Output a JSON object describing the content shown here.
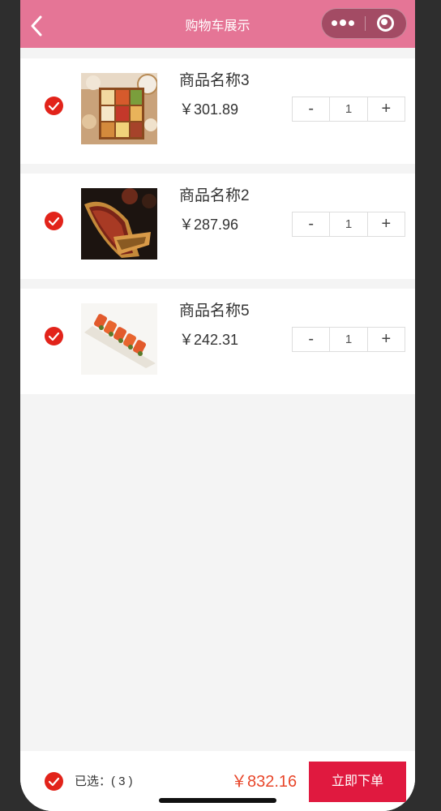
{
  "navbar": {
    "title": "购物车展示",
    "color": "#e57596"
  },
  "cart": {
    "currency": "￥",
    "items": [
      {
        "name": "商品名称3",
        "price": "￥301.89",
        "qty": "1",
        "image": "bento-box-image",
        "checked": true
      },
      {
        "name": "商品名称2",
        "price": "￥287.96",
        "qty": "1",
        "image": "grilled-sandwich-image",
        "checked": true
      },
      {
        "name": "商品名称5",
        "price": "￥242.31",
        "qty": "1",
        "image": "sushi-roll-image",
        "checked": true
      }
    ],
    "stepper": {
      "minus": "-",
      "plus": "+"
    }
  },
  "footer": {
    "selected_label": "已选：( 3 )",
    "total": "￥832.16",
    "order_button": "立即下单",
    "accent": "#e0193f",
    "total_color": "#e8462a"
  }
}
